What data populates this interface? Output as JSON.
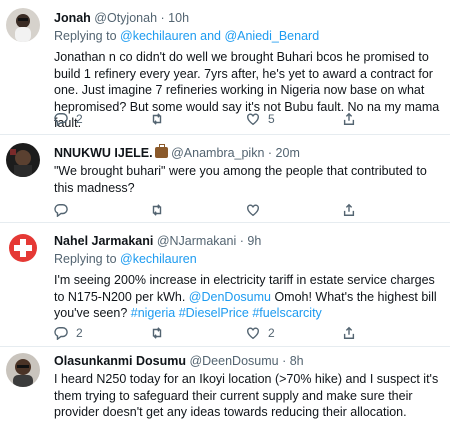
{
  "tweets": [
    {
      "name": "Jonah",
      "handle": "@Otyjonah",
      "sep": "·",
      "time": "10h",
      "reply_prefix": "Replying to",
      "reply_users": "@kechilauren and @Aniedi_Benard",
      "text": "Jonathan n co didn't do well we brought Buhari bcos he promised to build 1 refinery every year. 7yrs after, he's yet to award a contract for one. Just imagine 7 refineries working in Nigeria now base on what hepromised? But some would say it's not Bubu fault. No na my mama fault.",
      "replies": "2",
      "likes": "5"
    },
    {
      "name": "NNUKWU IJELE.",
      "handle": "@Anambra_pikn",
      "sep": "·",
      "time": "20m",
      "text": "\"We brought buhari\" were you among the people that contributed to this madness?"
    },
    {
      "name": "Nahel Jarmakani",
      "handle": "@NJarmakani",
      "sep": "·",
      "time": "9h",
      "reply_prefix": "Replying to",
      "reply_users": "@kechilauren",
      "text_a": "I'm seeing 200% increase in electricity tariff in estate service charges to N175-N200 per kWh. ",
      "mention": "@DenDosumu",
      "text_b": " Omoh! What's the highest bill you've seen? ",
      "hashtags": "#nigeria #DieselPrice #fuelscarcity",
      "replies": "2",
      "likes": "2"
    },
    {
      "name": "Olasunkanmi Dosumu",
      "handle": "@DeenDosumu",
      "sep": "·",
      "time": "8h",
      "text": "I heard N250 today for an Ikoyi location (>70% hike) and I suspect it's them trying to safeguard their current supply and make sure their provider doesn't get any ideas towards reducing their allocation."
    }
  ],
  "icons": {
    "reply": "reply-icon",
    "retweet": "retweet-icon",
    "like": "heart-icon",
    "share": "share-icon"
  }
}
